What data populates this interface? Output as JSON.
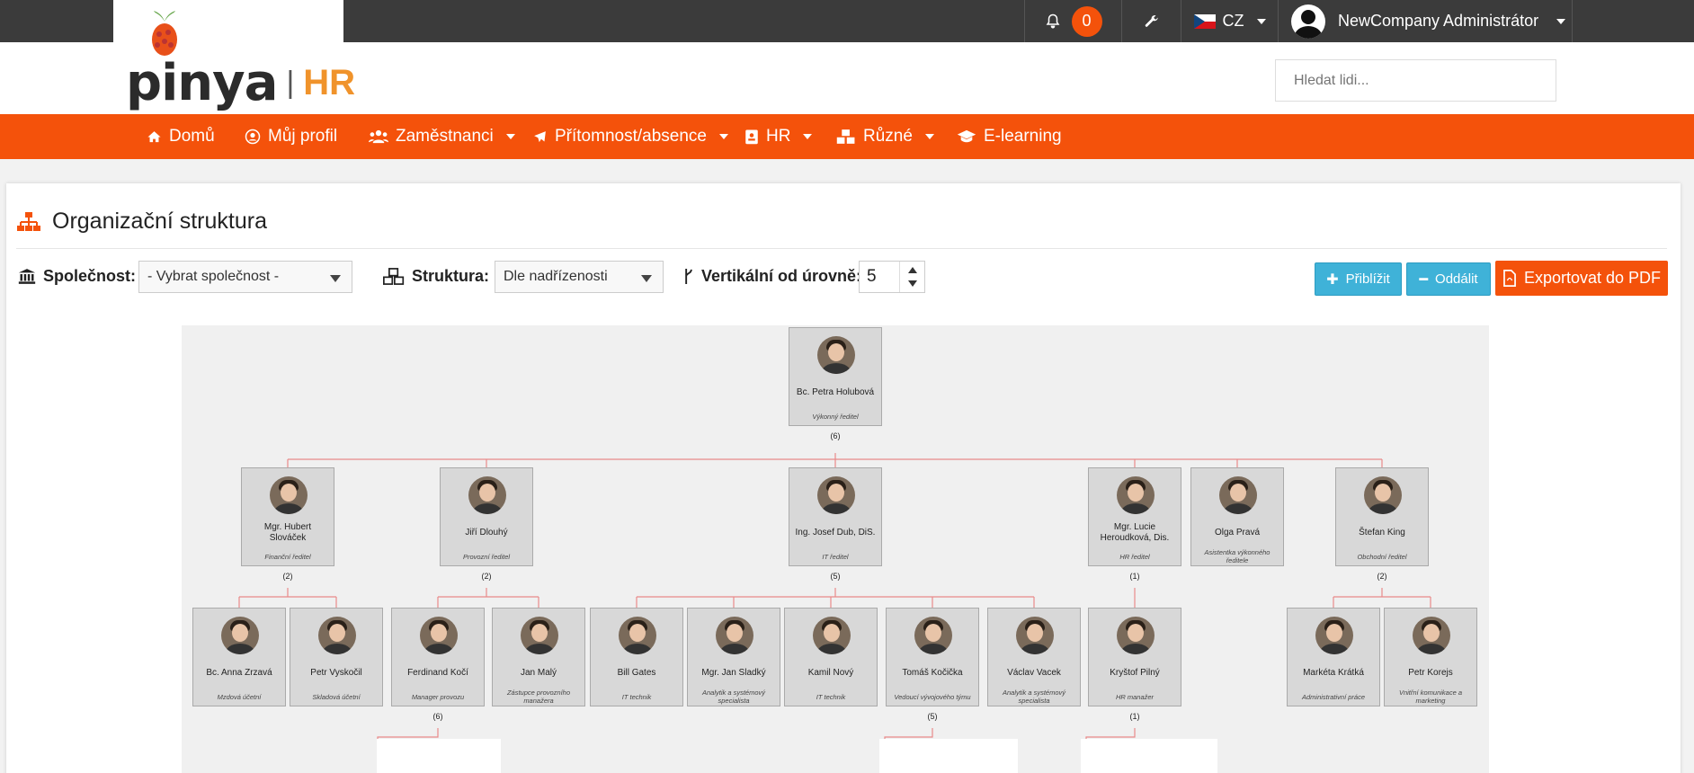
{
  "topbar": {
    "notifications_count": "0",
    "language": "CZ",
    "user_name": "NewCompany Administrátor"
  },
  "header": {
    "logo_word": "pinya",
    "logo_sep": "|",
    "logo_hr": "HR",
    "search_placeholder": "Hledat lidi..."
  },
  "nav": {
    "items": [
      {
        "label": "Domů",
        "icon": "home-icon"
      },
      {
        "label": "Můj profil",
        "icon": "user-circle-icon"
      },
      {
        "label": "Zaměstnanci",
        "icon": "users-icon"
      },
      {
        "label": "Přítomnost/absence",
        "icon": "plane-icon"
      },
      {
        "label": "HR",
        "icon": "id-badge-icon"
      },
      {
        "label": "Různé",
        "icon": "cubes-icon"
      },
      {
        "label": "E-learning",
        "icon": "graduation-cap-icon"
      }
    ]
  },
  "page": {
    "title": "Organizační struktura",
    "company_label": "Společnost:",
    "company_value": "- Vybrat společnost -",
    "structure_label": "Struktura:",
    "structure_value": "Dle nadřízenosti",
    "vertical_label": "Vertikální od úrovně:",
    "vertical_value": "5",
    "zoom_in_label": "Přiblížit",
    "zoom_out_label": "Oddálit",
    "export_label": "Exportovat do PDF"
  },
  "org": {
    "root": {
      "name": "Bc. Petra Holubová",
      "role": "Výkonný ředitel",
      "count": "(6)"
    },
    "level1": [
      {
        "name": "Mgr. Hubert Slováček",
        "role": "Finanční ředitel",
        "count": "(2)"
      },
      {
        "name": "Jiří Dlouhý",
        "role": "Provozní ředitel",
        "count": "(2)"
      },
      {
        "name": "Ing. Josef Dub, DiS.",
        "role": "IT ředitel",
        "count": "(5)"
      },
      {
        "name": "Mgr. Lucie Heroudková, Dis.",
        "role": "HR ředitel",
        "count": "(1)"
      },
      {
        "name": "Olga Pravá",
        "role": "Asistentka výkonného ředitele",
        "count": ""
      },
      {
        "name": "Štefan King",
        "role": "Obchodní ředitel",
        "count": "(2)"
      }
    ],
    "level2": [
      {
        "name": "Bc. Anna Zrzavá",
        "role": "Mzdová účetní",
        "count": ""
      },
      {
        "name": "Petr Vyskočil",
        "role": "Skladová účetní",
        "count": ""
      },
      {
        "name": "Ferdinand Kočí",
        "role": "Manager provozu",
        "count": "(6)"
      },
      {
        "name": "Jan Malý",
        "role": "Zástupce provozního manažera",
        "count": ""
      },
      {
        "name": "Bill Gates",
        "role": "IT technik",
        "count": ""
      },
      {
        "name": "Mgr. Jan Sladký",
        "role": "Analytik a systémový specialista",
        "count": ""
      },
      {
        "name": "Kamil Nový",
        "role": "IT technik",
        "count": ""
      },
      {
        "name": "Tomáš Kočička",
        "role": "Vedoucí vývojového týmu",
        "count": "(5)"
      },
      {
        "name": "Václav Vacek",
        "role": "Analytik a systémový specialista",
        "count": ""
      },
      {
        "name": "Kryštof Pilný",
        "role": "HR manažer",
        "count": "(1)"
      },
      {
        "name": "Markéta Krátká",
        "role": "Administrativní práce",
        "count": ""
      },
      {
        "name": "Petr Korejs",
        "role": "Vnitřní komunikace a marketing",
        "count": ""
      }
    ]
  },
  "colors": {
    "brand_orange": "#f4520b",
    "topbar_dark": "#3b3b3b",
    "button_blue": "#3fb2d8",
    "connector": "#e88a8a"
  }
}
